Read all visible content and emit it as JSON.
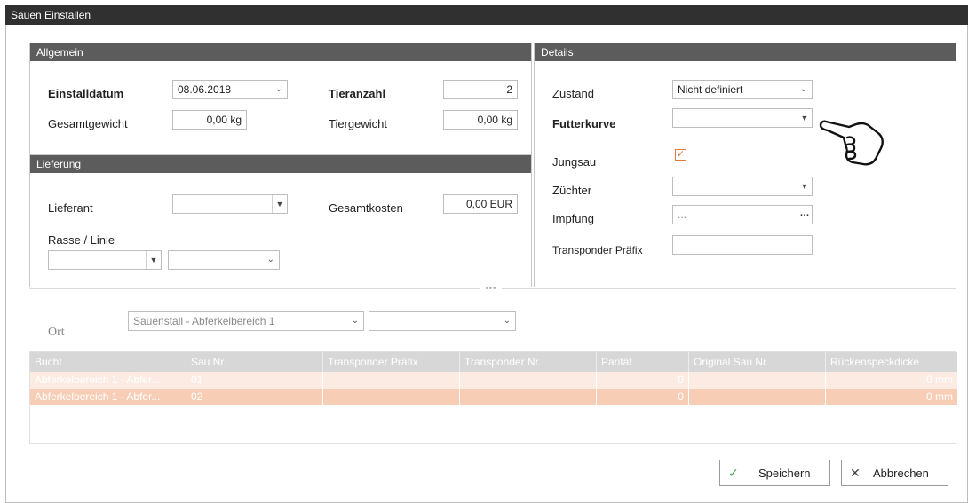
{
  "window": {
    "title": "Sauen Einstallen"
  },
  "allgemein": {
    "header": "Allgemein",
    "einstalldatum_label": "Einstalldatum",
    "einstalldatum_value": "08.06.2018",
    "tieranzahl_label": "Tieranzahl",
    "tieranzahl_value": "2",
    "gesamtgewicht_label": "Gesamtgewicht",
    "gesamtgewicht_value": "0,00 kg",
    "tiergewicht_label": "Tiergewicht",
    "tiergewicht_value": "0,00 kg"
  },
  "lieferung": {
    "header": "Lieferung",
    "lieferant_label": "Lieferant",
    "lieferant_value": "",
    "gesamtkosten_label": "Gesamtkosten",
    "gesamtkosten_value": "0,00 EUR",
    "rasse_label": "Rasse / Linie",
    "rasse_value": "",
    "linie_value": ""
  },
  "details": {
    "header": "Details",
    "zustand_label": "Zustand",
    "zustand_value": "Nicht definiert",
    "futterkurve_label": "Futterkurve",
    "futterkurve_value": "",
    "jungsau_label": "Jungsau",
    "jungsau_checked": true,
    "zuechter_label": "Züchter",
    "zuechter_value": "",
    "impfung_label": "Impfung",
    "impfung_value": "...",
    "transponder_label": "Transponder Präfix",
    "transponder_value": ""
  },
  "ort": {
    "label": "Ort",
    "stall_value": "Sauenstall - Abferkelbereich 1",
    "second_value": ""
  },
  "table": {
    "columns": [
      "Bucht",
      "Sau Nr.",
      "Transponder Präfix",
      "Transponder Nr.",
      "Parität",
      "Original Sau Nr.",
      "Rückenspeckdicke"
    ],
    "rows": [
      {
        "bucht": "Abferkelbereich 1 - Abfer...",
        "sau_nr": "01",
        "transponder_praefix": "",
        "transponder_nr": "",
        "paritaet": "0",
        "original_sau_nr": "",
        "rueckenspeckdicke": "0 mm"
      },
      {
        "bucht": "Abferkelbereich 1 - Abfer...",
        "sau_nr": "02",
        "transponder_praefix": "",
        "transponder_nr": "",
        "paritaet": "0",
        "original_sau_nr": "",
        "rueckenspeckdicke": "0 mm"
      }
    ]
  },
  "buttons": {
    "save": "Speichern",
    "cancel": "Abbrechen"
  },
  "icons": {
    "save": "check-icon",
    "cancel": "close-icon",
    "pointer": "pointing-hand-icon"
  },
  "colors": {
    "titlebar": "#303030",
    "panel_header": "#5c5c5c",
    "row_light": "#fcebe2",
    "row_selected": "#f7cdb6",
    "check_accent": "#e07b39",
    "save_check": "#3aa24b"
  }
}
